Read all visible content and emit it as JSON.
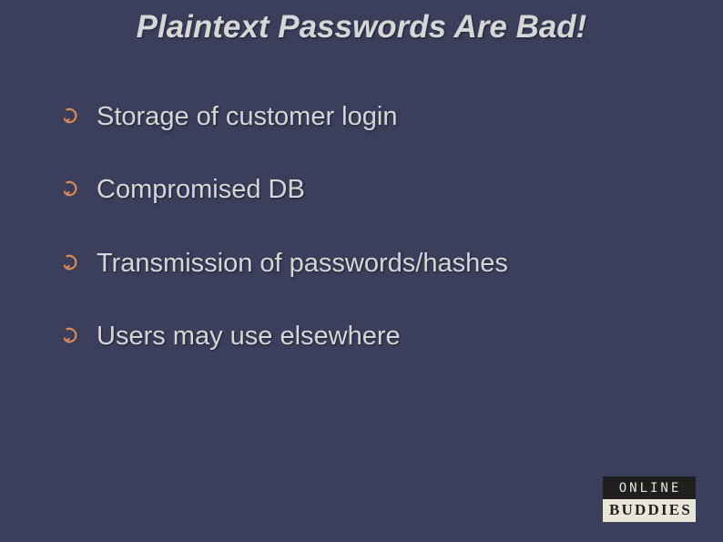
{
  "title": "Plaintext Passwords Are Bad!",
  "bullets": [
    "Storage of customer login",
    "Compromised DB",
    "Transmission of passwords/hashes",
    "Users may use elsewhere"
  ],
  "logo": {
    "top": "ONLINE",
    "bottom": "BUDDIES"
  }
}
